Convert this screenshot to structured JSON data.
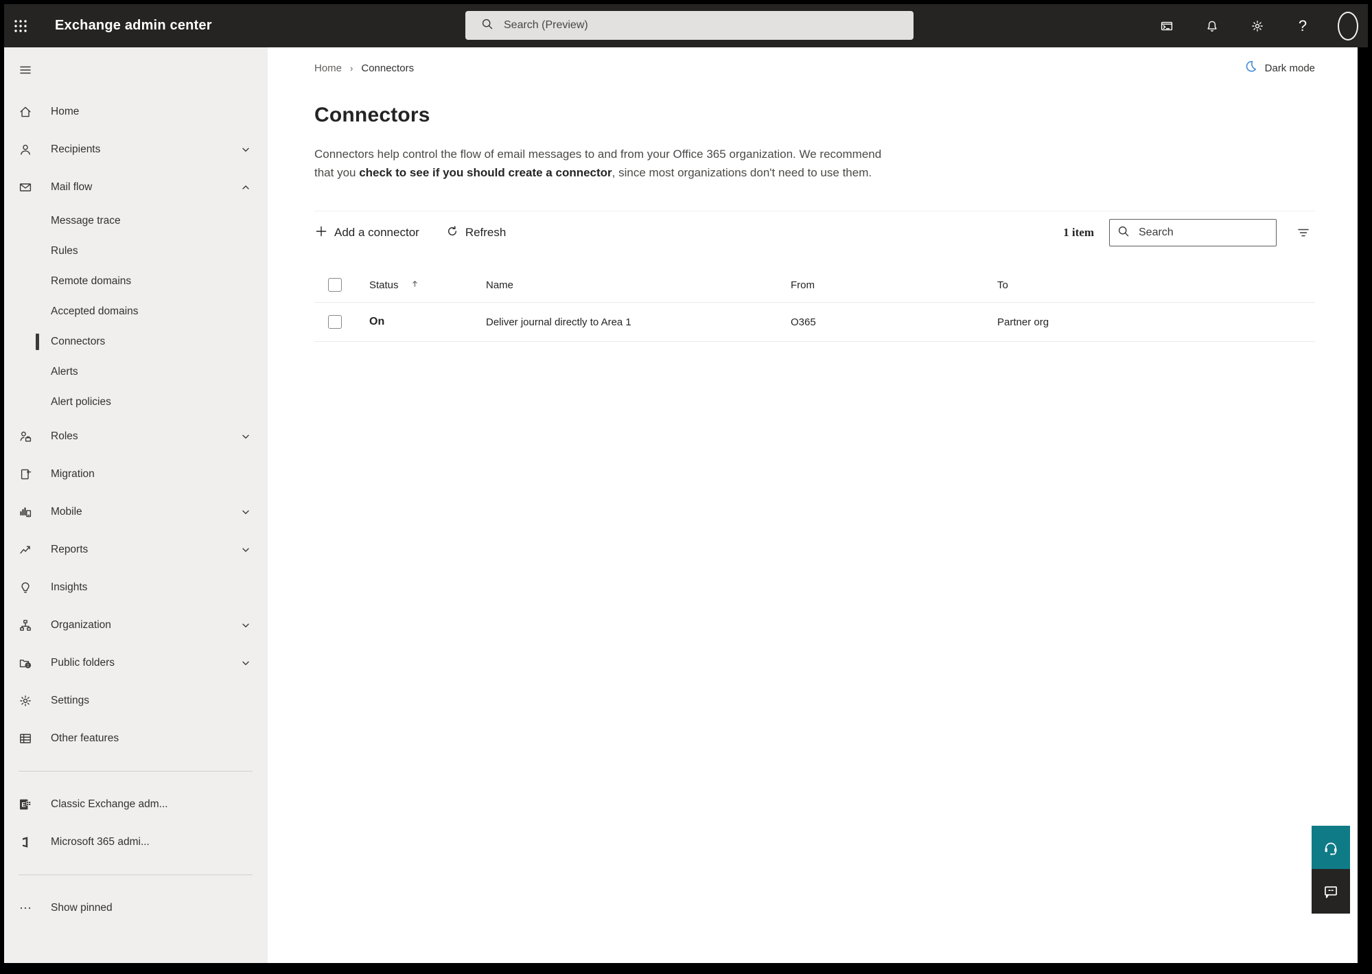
{
  "topbar": {
    "title": "Exchange admin center",
    "search_placeholder": "Search (Preview)",
    "actions": [
      {
        "icon": "terminal"
      },
      {
        "icon": "bell"
      },
      {
        "icon": "gear"
      },
      {
        "icon": "help"
      },
      {
        "icon": "avatar"
      }
    ]
  },
  "sidebar": {
    "items": [
      {
        "label": "Home",
        "icon": "home",
        "kind": "top"
      },
      {
        "label": "Recipients",
        "icon": "person",
        "kind": "top",
        "chevron": "down"
      },
      {
        "label": "Mail flow",
        "icon": "mail",
        "kind": "top",
        "chevron": "up"
      },
      {
        "label": "Message trace",
        "kind": "sub"
      },
      {
        "label": "Rules",
        "kind": "sub"
      },
      {
        "label": "Remote domains",
        "kind": "sub"
      },
      {
        "label": "Accepted domains",
        "kind": "sub"
      },
      {
        "label": "Connectors",
        "kind": "sub",
        "selected": true
      },
      {
        "label": "Alerts",
        "kind": "sub"
      },
      {
        "label": "Alert policies",
        "kind": "sub"
      },
      {
        "label": "Roles",
        "icon": "roles",
        "kind": "top",
        "chevron": "down"
      },
      {
        "label": "Migration",
        "icon": "migration",
        "kind": "top"
      },
      {
        "label": "Mobile",
        "icon": "mobile",
        "kind": "top",
        "chevron": "down"
      },
      {
        "label": "Reports",
        "icon": "reports",
        "kind": "top",
        "chevron": "down"
      },
      {
        "label": "Insights",
        "icon": "insights",
        "kind": "top"
      },
      {
        "label": "Organization",
        "icon": "organization",
        "kind": "top",
        "chevron": "down"
      },
      {
        "label": "Public folders",
        "icon": "public-folders",
        "kind": "top",
        "chevron": "down"
      },
      {
        "label": "Settings",
        "icon": "settings",
        "kind": "top"
      },
      {
        "label": "Other features",
        "icon": "other-features",
        "kind": "top"
      },
      {
        "kind": "divider"
      },
      {
        "label": "Classic Exchange adm...",
        "icon": "exchange-logo",
        "kind": "top"
      },
      {
        "label": "Microsoft 365 admi...",
        "icon": "m365-logo",
        "kind": "top"
      },
      {
        "kind": "divider"
      },
      {
        "label": "Show pinned",
        "icon": "pinned",
        "kind": "top"
      }
    ]
  },
  "breadcrumb": {
    "home": "Home",
    "current": "Connectors"
  },
  "dark_mode_label": "Dark mode",
  "page": {
    "title": "Connectors",
    "desc_pre": "Connectors help control the flow of email messages to and from your Office 365 organization. We recommend that you ",
    "desc_link": "check to see if you should create a connector",
    "desc_post": ", since most organizations don't need to use them."
  },
  "toolbar": {
    "add_label": "Add a connector",
    "refresh_label": "Refresh",
    "count": "1 item",
    "search_placeholder": "Search"
  },
  "table": {
    "headers": [
      "Status",
      "Name",
      "From",
      "To"
    ],
    "sort_column": "Status",
    "sort_direction": "asc",
    "rows": [
      {
        "status": "On",
        "name": "Deliver journal directly to Area 1",
        "from": "O365",
        "to": "Partner org"
      }
    ]
  },
  "colors": {
    "topbar_bg": "#252423",
    "sidebar_bg": "#f1efee",
    "accent_teal": "#0f7b86",
    "feedback_dark": "#252423",
    "moon_blue": "#4a8fd9",
    "selected_indicator": "#3b3a39"
  }
}
